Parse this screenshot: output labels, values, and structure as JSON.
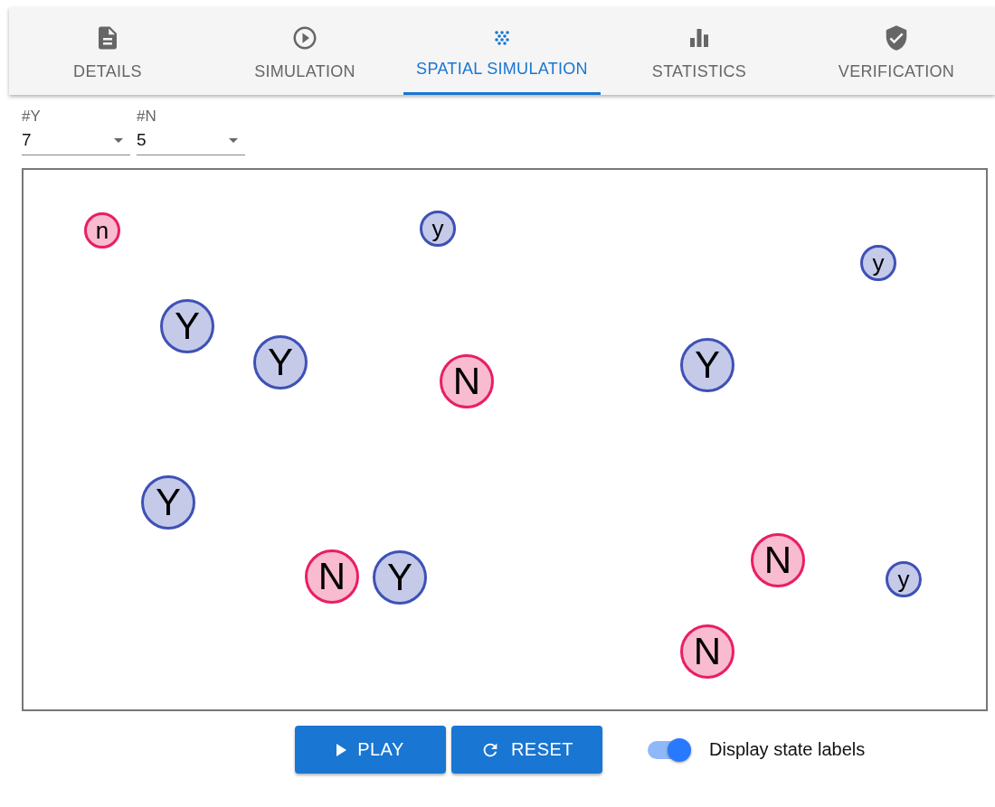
{
  "tabs": [
    {
      "label": "DETAILS",
      "selected": false
    },
    {
      "label": "SIMULATION",
      "selected": false
    },
    {
      "label": "SPATIAL SIMULATION",
      "selected": true
    },
    {
      "label": "STATISTICS",
      "selected": false
    },
    {
      "label": "VERIFICATION",
      "selected": false
    }
  ],
  "selects": [
    {
      "label": "#Y",
      "value": "7"
    },
    {
      "label": "#N",
      "value": "5"
    }
  ],
  "agents": [
    {
      "label": "n",
      "kind": "no"
    },
    {
      "label": "y",
      "kind": "yes"
    },
    {
      "label": "y",
      "kind": "yes"
    },
    {
      "label": "Y",
      "kind": "yes"
    },
    {
      "label": "Y",
      "kind": "yes"
    },
    {
      "label": "Y",
      "kind": "yes"
    },
    {
      "label": "N",
      "kind": "no"
    },
    {
      "label": "Y",
      "kind": "yes"
    },
    {
      "label": "N",
      "kind": "no"
    },
    {
      "label": "N",
      "kind": "no"
    },
    {
      "label": "Y",
      "kind": "yes"
    },
    {
      "label": "y",
      "kind": "yes"
    },
    {
      "label": "N",
      "kind": "no"
    }
  ],
  "buttons": [
    {
      "label": "PLAY"
    },
    {
      "label": "RESET"
    }
  ],
  "toggle": {
    "label": "Display state labels",
    "on": true
  }
}
